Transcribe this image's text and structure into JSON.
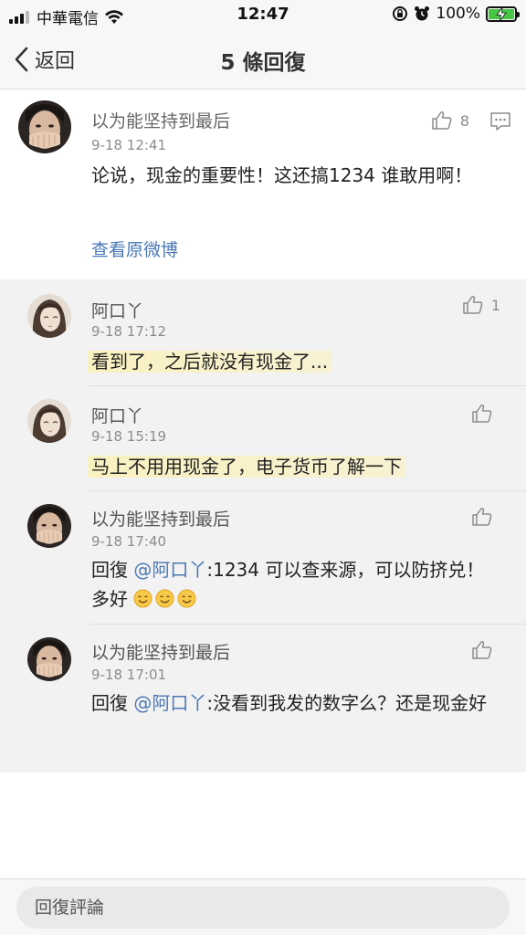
{
  "status_bar": {
    "carrier": "中華電信",
    "time": "12:47",
    "battery_percent": "100%",
    "icons": [
      "signal-icon",
      "wifi-icon",
      "rotation-lock-icon",
      "alarm-icon",
      "battery-charging-icon"
    ]
  },
  "nav": {
    "back_label": "返回",
    "title": "5 條回復"
  },
  "post": {
    "author": "以为能坚持到最后",
    "time": "9-18 12:41",
    "likes": "8",
    "text": "论说，现金的重要性！这还搞1234 谁敢用啊！",
    "view_original": "查看原微博"
  },
  "replies": [
    {
      "author": "阿口丫",
      "time": "9-18 17:12",
      "likes": "1",
      "text": "看到了，之后就没有现金了...",
      "highlight": true
    },
    {
      "author": "阿口丫",
      "time": "9-18 15:19",
      "likes": "",
      "text": "马上不用用现金了，电子货币了解一下",
      "highlight": true
    },
    {
      "author": "以为能坚持到最后",
      "time": "9-18 17:40",
      "likes": "",
      "reply_prefix": "回復",
      "mention": "@阿口丫",
      "text": ":1234 可以查来源，可以防挤兑！多好"
    },
    {
      "author": "以为能坚持到最后",
      "time": "9-18 17:01",
      "likes": "",
      "reply_prefix": "回復",
      "mention": "@阿口丫",
      "text": ":没看到我发的数字么？还是现金好"
    }
  ],
  "composer": {
    "placeholder": "回復評論"
  },
  "colors": {
    "link": "#4a78b5",
    "battery": "#49c545",
    "highlight": "#faf1be",
    "reply_background": "#f2f2f2"
  }
}
